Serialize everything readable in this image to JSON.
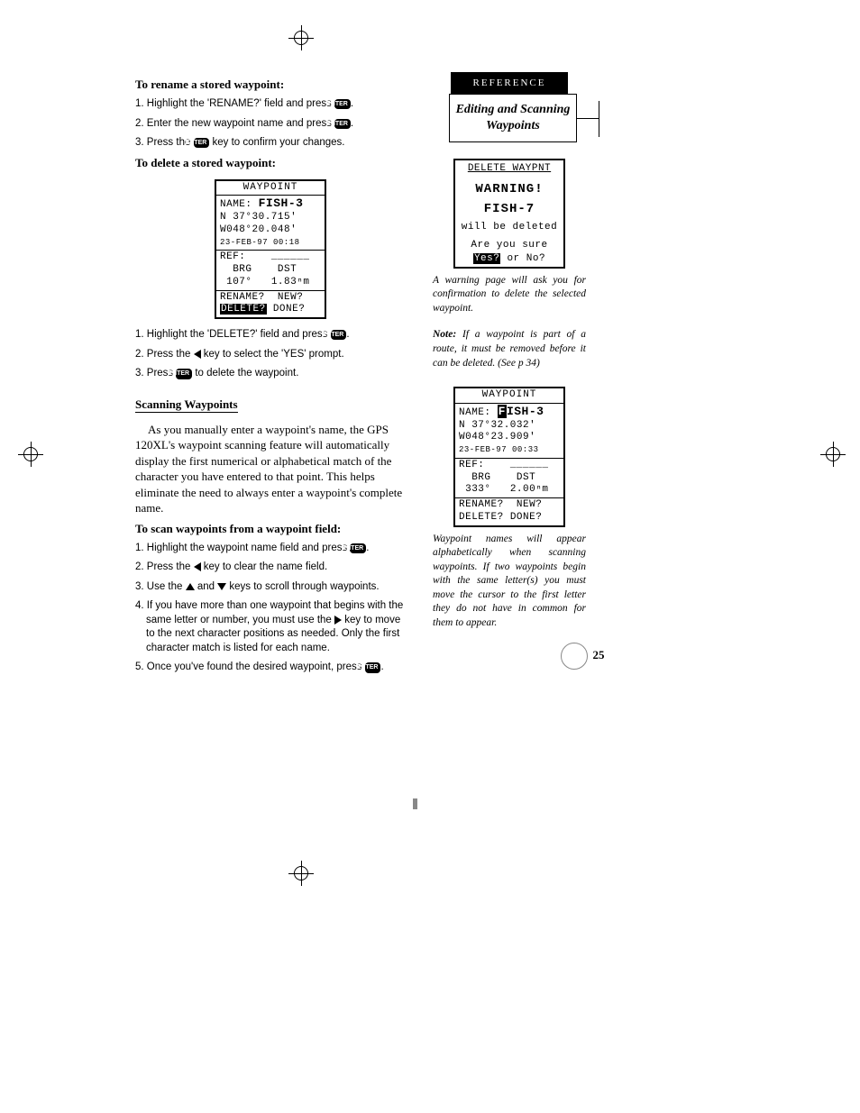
{
  "reference_label": "REFERENCE",
  "topic_title": "Editing and Scanning Waypoints",
  "left": {
    "h_rename": "To rename a stored waypoint:",
    "rename_steps": {
      "s1a": "1. Highlight the 'RENAME?' field and press ",
      "s1b": ".",
      "s2a": "2. Enter the new waypoint name and press ",
      "s2b": ".",
      "s3a": "3. Press the ",
      "s3b": " key to confirm your changes."
    },
    "h_delete": "To delete a stored waypoint:",
    "delete_steps": {
      "s1a": "1. Highlight the 'DELETE?' field and press ",
      "s1b": ".",
      "s2a": "2. Press the ",
      "s2b": " key to select the 'YES' prompt.",
      "s3a": "3. Press ",
      "s3b": " to delete the waypoint."
    },
    "h_scan": "Scanning Waypoints",
    "scan_body": "As you manually enter a waypoint's name, the GPS 120XL's waypoint scanning feature will automatically display the first numerical or alphabetical match of the character you have entered to that point. This helps eliminate the need to always enter a waypoint's complete name.",
    "h_scan_steps": "To scan waypoints from a waypoint field:",
    "scan_steps": {
      "s1a": "1. Highlight the waypoint name field and press ",
      "s1b": ".",
      "s2a": "2. Press the ",
      "s2b": " key to clear the name field.",
      "s3a": "3. Use the ",
      "s3b": " and ",
      "s3c": " keys to scroll through waypoints.",
      "s4a": "4. If you have more than one waypoint that begins with the same letter or number, you must use the ",
      "s4b": " key to move to the next character positions as needed. Only the first character match is listed for each name.",
      "s5a": "5. Once you've found the desired waypoint, press ",
      "s5b": "."
    },
    "enter_label": "ENTER"
  },
  "screen1": {
    "title": "WAYPOINT",
    "name_label": "NAME:",
    "name_value": "FISH-3",
    "lat": "N  37°30.715'",
    "lon": "W048°20.048'",
    "date": "23-FEB-97 00:18",
    "ref": "REF:",
    "ref_blank": "______",
    "brg_label": "BRG",
    "dst_label": "DST",
    "brg_val": "107°",
    "dst_val": "1.83ⁿm",
    "rename": "RENAME?",
    "new": "NEW?",
    "delete": "DELETE?",
    "done": "DONE?"
  },
  "warn_screen": {
    "header": "DELETE WAYPNT",
    "warning": "WARNING!",
    "wpt": "FISH-7",
    "line1": "will be deleted",
    "line2": "Are you sure",
    "yes": "Yes?",
    "or": " or ",
    "no": "No?"
  },
  "caption1": "A warning page will ask you for confirmation to delete the selected waypoint.",
  "note_label": "Note:",
  "note_text": " If a waypoint is part of a route, it must be removed before it can be deleted. (See p 34)",
  "screen2": {
    "title": "WAYPOINT",
    "name_label": "NAME:",
    "name_first": "F",
    "name_rest": "ISH-3",
    "lat": "N  37°32.032'",
    "lon": "W048°23.909'",
    "date": "23-FEB-97 00:33",
    "ref": "REF:",
    "ref_blank": "______",
    "brg_label": "BRG",
    "dst_label": "DST",
    "brg_val": "333°",
    "dst_val": "2.00ⁿm",
    "rename": "RENAME?",
    "new": "NEW?",
    "delete": "DELETE?",
    "done": "DONE?"
  },
  "caption2": "Waypoint names will appear alphabetically when scanning waypoints. If two waypoints begin with the same letter(s) you must move the cursor to the first letter they do not have in common for them to appear.",
  "page_number": "25"
}
